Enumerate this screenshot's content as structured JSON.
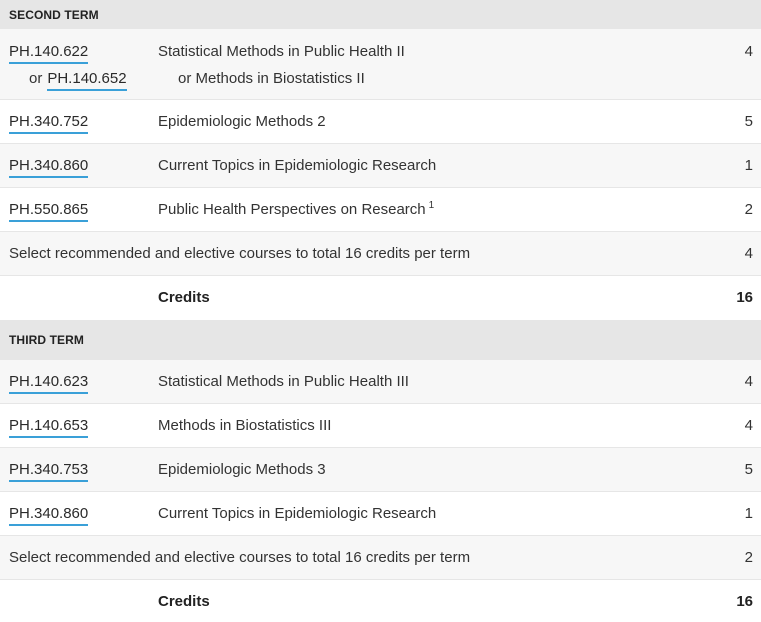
{
  "terms": [
    {
      "header": "SECOND TERM",
      "courses": [
        {
          "code": "PH.140.622",
          "title": "Statistical Methods in Public Health II",
          "hours": "4",
          "alt_or": "or",
          "alt_code": "PH.140.652",
          "alt_title": "or Methods in Biostatistics II"
        },
        {
          "code": "PH.340.752",
          "title": "Epidemiologic Methods 2",
          "hours": "5"
        },
        {
          "code": "PH.340.860",
          "title": "Current Topics in Epidemiologic Research",
          "hours": "1"
        },
        {
          "code": "PH.550.865",
          "title": "Public Health Perspectives on Research",
          "footnote": "1",
          "hours": "2"
        }
      ],
      "select_text": "Select recommended and elective courses to total 16 credits per term",
      "select_hours": "4",
      "credits_label": "Credits",
      "credits_total": "16"
    },
    {
      "header": "THIRD TERM",
      "courses": [
        {
          "code": "PH.140.623",
          "title": "Statistical Methods in Public Health III",
          "hours": "4"
        },
        {
          "code": "PH.140.653",
          "title": "Methods in Biostatistics III",
          "hours": "4"
        },
        {
          "code": "PH.340.753",
          "title": "Epidemiologic Methods 3",
          "hours": "5"
        },
        {
          "code": "PH.340.860",
          "title": "Current Topics in Epidemiologic Research",
          "hours": "1"
        }
      ],
      "select_text": "Select recommended and elective courses to total 16 credits per term",
      "select_hours": "2",
      "credits_label": "Credits",
      "credits_total": "16"
    }
  ]
}
